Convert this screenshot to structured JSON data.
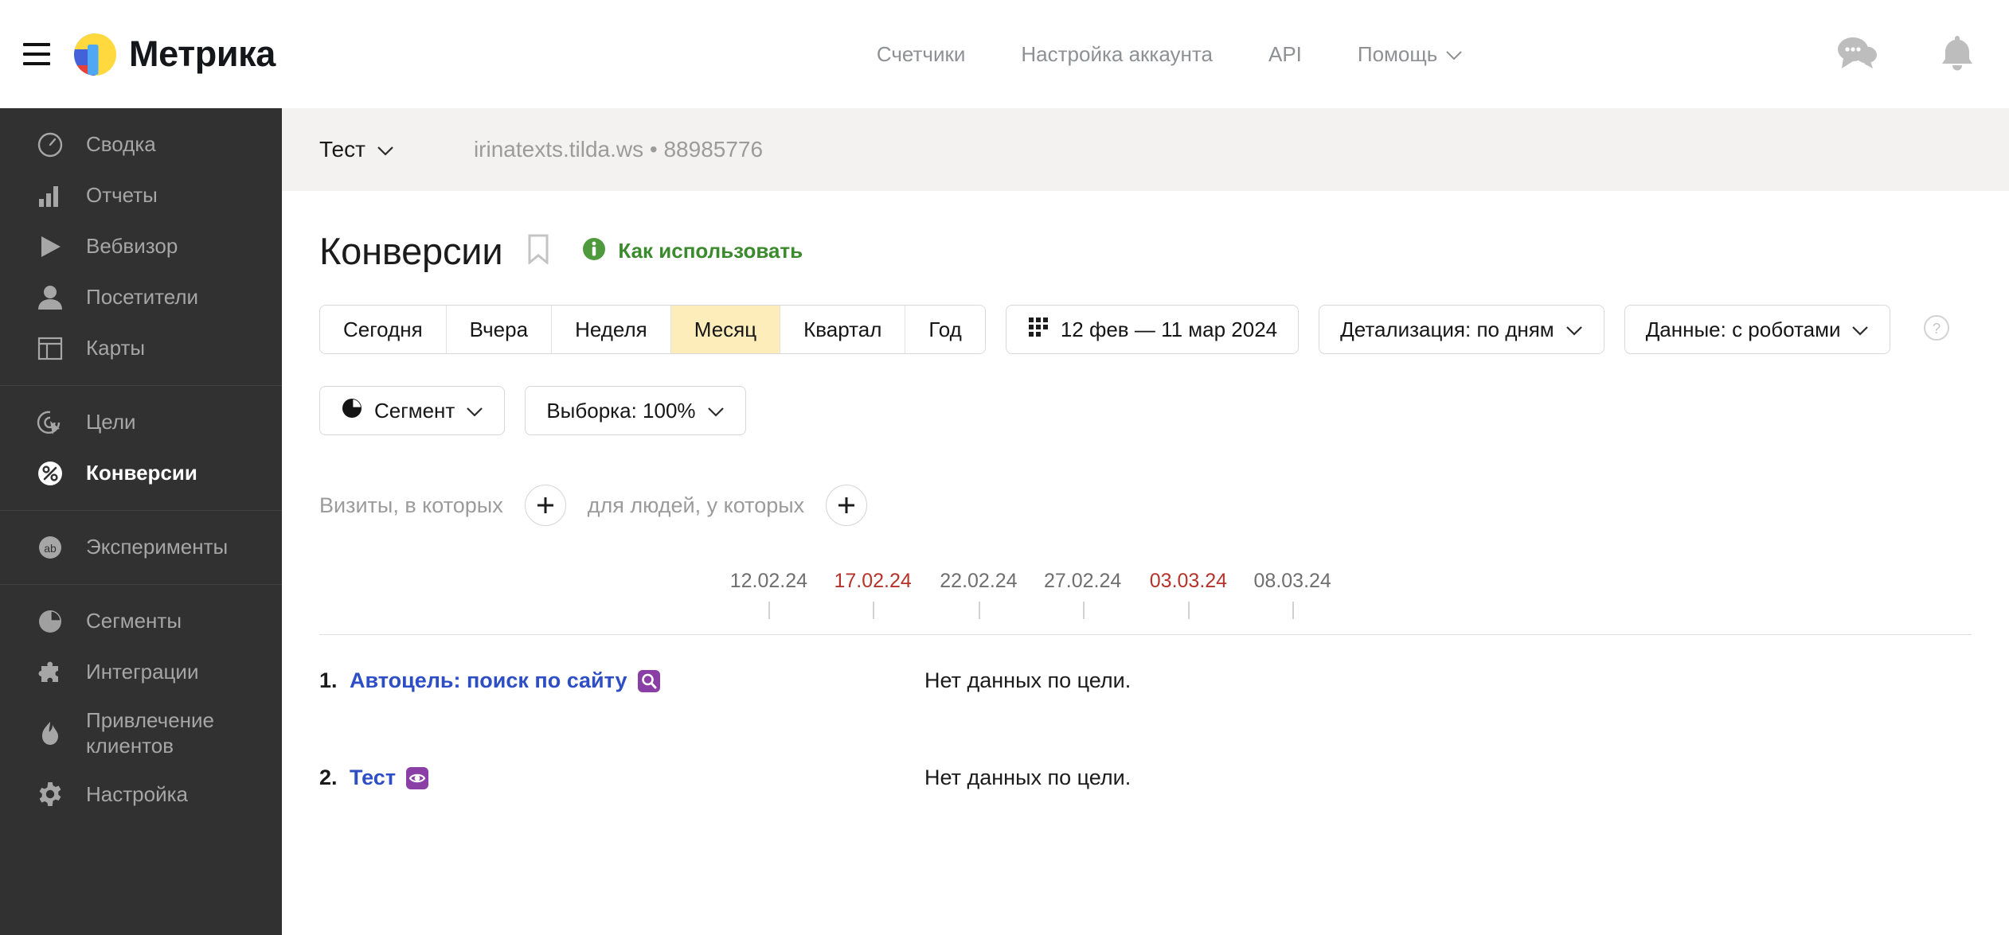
{
  "topbar": {
    "menu_icon": "hamburger-icon",
    "logo_text": "Метрика",
    "logo_icon": "metrika-logo-icon",
    "nav": [
      {
        "label": "Счетчики",
        "caret": false
      },
      {
        "label": "Настройка аккаунта",
        "caret": false
      },
      {
        "label": "API",
        "caret": false
      },
      {
        "label": "Помощь",
        "caret": true
      }
    ],
    "right_icons": [
      {
        "name": "chat-icon"
      },
      {
        "name": "bell-icon"
      }
    ]
  },
  "sidebar": {
    "groups": [
      {
        "items": [
          {
            "label": "Сводка",
            "icon": "gauge-icon",
            "active": false
          },
          {
            "label": "Отчеты",
            "icon": "bar-chart-icon",
            "active": false
          },
          {
            "label": "Вебвизор",
            "icon": "play-icon",
            "active": false
          },
          {
            "label": "Посетители",
            "icon": "person-icon",
            "active": false
          },
          {
            "label": "Карты",
            "icon": "layout-map-icon",
            "active": false
          }
        ]
      },
      {
        "items": [
          {
            "label": "Цели",
            "icon": "target-cursor-icon",
            "active": false
          },
          {
            "label": "Конверсии",
            "icon": "percent-circle-icon",
            "active": true
          }
        ]
      },
      {
        "items": [
          {
            "label": "Эксперименты",
            "icon": "ab-test-icon",
            "active": false
          }
        ]
      },
      {
        "items": [
          {
            "label": "Сегменты",
            "icon": "pie-chart-icon",
            "active": false
          },
          {
            "label": "Интеграции",
            "icon": "puzzle-icon",
            "active": false
          },
          {
            "label": "Привлечение клиентов",
            "icon": "flame-icon",
            "active": false
          },
          {
            "label": "Настройка",
            "icon": "gear-icon",
            "active": false
          }
        ]
      }
    ]
  },
  "breadcrumb": {
    "counter_name": "Тест",
    "site_and_id": "irinatexts.tilda.ws • 88985776"
  },
  "page": {
    "title": "Конверсии",
    "bookmark_icon": "bookmark-icon",
    "howto_icon": "info-icon",
    "howto_label": "Как использовать"
  },
  "controls": {
    "periods": [
      {
        "label": "Сегодня",
        "active": false
      },
      {
        "label": "Вчера",
        "active": false
      },
      {
        "label": "Неделя",
        "active": false
      },
      {
        "label": "Месяц",
        "active": true
      },
      {
        "label": "Квартал",
        "active": false
      },
      {
        "label": "Год",
        "active": false
      }
    ],
    "date_range": {
      "icon": "calendar-grid-icon",
      "label": "12 фев — 11 мар 2024"
    },
    "detail": {
      "label": "Детализация: по дням",
      "caret": true
    },
    "data_source": {
      "label": "Данные: с роботами",
      "caret": true
    },
    "help_icon": "question-circle-icon",
    "segment": {
      "icon": "pie-chart-icon",
      "label": "Сегмент",
      "caret": true
    },
    "sampling": {
      "label": "Выборка: 100%",
      "caret": true
    }
  },
  "filters": {
    "visits_label": "Визиты, в которых",
    "visits_add_icon": "plus-icon",
    "people_label": "для людей, у которых",
    "people_add_icon": "plus-icon"
  },
  "chart_data": {
    "type": "line",
    "title": "Конверсии",
    "xlabel": "",
    "ylabel": "",
    "x_tick_labels": [
      "12.02.24",
      "17.02.24",
      "22.02.24",
      "27.02.24",
      "03.03.24",
      "08.03.24"
    ],
    "x_tick_weekend": [
      false,
      true,
      false,
      false,
      true,
      false
    ],
    "x_tick_positions_pct": [
      27.2,
      33.5,
      39.9,
      46.2,
      52.6,
      58.9
    ],
    "axis_range_label": "12 фев — 11 мар 2024",
    "grid": false,
    "series": [
      {
        "name": "Автоцель: поиск по сайту",
        "values": [],
        "empty_message": "Нет данных по цели."
      },
      {
        "name": "Тест",
        "values": [],
        "empty_message": "Нет данных по цели."
      }
    ]
  },
  "goals": [
    {
      "number": "1.",
      "name": "Автоцель: поиск по сайту",
      "badge_icon": "search-badge-icon",
      "message": "Нет данных по цели."
    },
    {
      "number": "2.",
      "name": "Тест",
      "badge_icon": "eye-badge-icon",
      "message": "Нет данных по цели."
    }
  ],
  "colors": {
    "accent_yellow": "#fcedbb",
    "link_blue": "#2e4ec6",
    "green": "#3c8a2e",
    "weekend_red": "#b5332b",
    "badge_purple": "#8a3fa6",
    "sidebar_bg": "#313131"
  }
}
